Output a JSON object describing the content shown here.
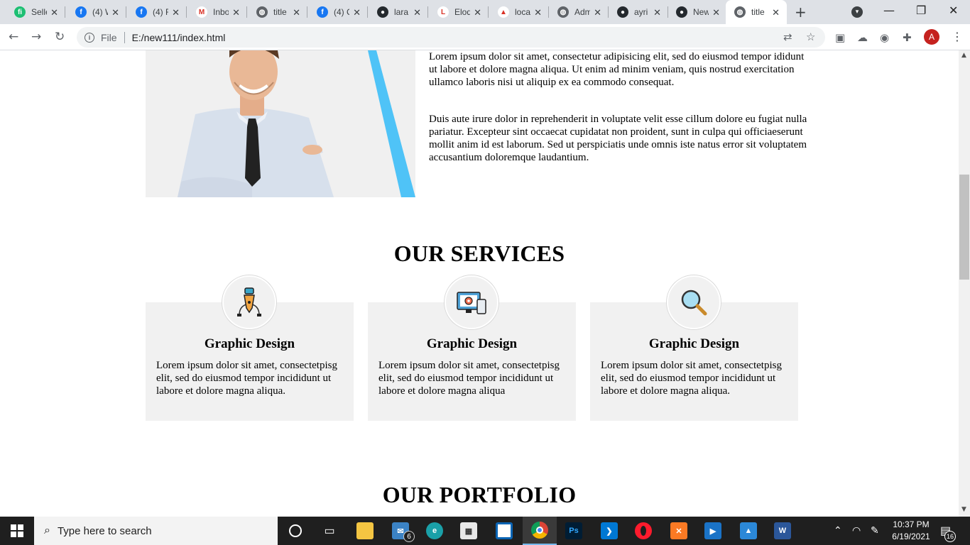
{
  "browser": {
    "tabs": [
      {
        "title": "Selle",
        "icon": "fiverr-icon",
        "color": "#1dbf73",
        "glyph": "fi"
      },
      {
        "title": "(4) W",
        "icon": "facebook-icon",
        "color": "#1877f2",
        "glyph": "f"
      },
      {
        "title": "(4) F",
        "icon": "facebook-icon",
        "color": "#1877f2",
        "glyph": "f"
      },
      {
        "title": "Inbo",
        "icon": "gmail-icon",
        "color": "#ffffff",
        "glyph": "M"
      },
      {
        "title": "title",
        "icon": "globe-icon",
        "color": "#5f6368",
        "glyph": "◍"
      },
      {
        "title": "(4) C",
        "icon": "facebook-icon",
        "color": "#1877f2",
        "glyph": "f"
      },
      {
        "title": "lara",
        "icon": "github-icon",
        "color": "#24292e",
        "glyph": "●"
      },
      {
        "title": "Eloq",
        "icon": "laravel-icon",
        "color": "#ffffff",
        "glyph": "L"
      },
      {
        "title": "loca",
        "icon": "phpmyadmin-icon",
        "color": "#ffffff",
        "glyph": "▲"
      },
      {
        "title": "Adm",
        "icon": "globe-icon",
        "color": "#5f6368",
        "glyph": "◍"
      },
      {
        "title": "ayri",
        "icon": "github-icon",
        "color": "#24292e",
        "glyph": "●"
      },
      {
        "title": "New",
        "icon": "github-icon",
        "color": "#24292e",
        "glyph": "●"
      },
      {
        "title": "title",
        "icon": "globe-icon",
        "color": "#5f6368",
        "glyph": "◍",
        "active": true
      }
    ],
    "close_glyph": "✕",
    "new_tab_glyph": "+",
    "address": {
      "scheme_chip": "File",
      "url": "E:/new111/index.html"
    },
    "profile_initial": "A"
  },
  "page": {
    "about": {
      "paragraphs": [
        "Lorem ipsum dolor sit amet, consectetur adipisicing elit, sed do eiusmod tempor ididunt ut labore et dolore magna aliqua. Ut enim ad minim veniam, quis nostrud exercitation ullamco laboris nisi ut aliquip ex ea commodo consequat.",
        "Duis aute irure dolor in reprehenderit in voluptate velit esse cillum dolore eu fugiat nulla pariatur. Excepteur sint occaecat cupidatat non proident, sunt in culpa qui officiaeserunt mollit anim id est laborum. Sed ut perspiciatis unde omnis iste natus error sit voluptatem accusantium doloremque laudantium."
      ]
    },
    "services": {
      "title": "OUR SERVICES",
      "cards": [
        {
          "icon": "pen-tool-icon",
          "title": "Graphic Design",
          "text": "Lorem ipsum dolor sit amet, consectetpisg elit, sed do eiusmod tempor incididunt ut labore et dolore magna aliqua."
        },
        {
          "icon": "monitor-gear-icon",
          "title": "Graphic Design",
          "text": "Lorem ipsum dolor sit amet, consectetpisg elit, sed do eiusmod tempor incididunt ut labore et dolore magna aliqua"
        },
        {
          "icon": "magnifier-icon",
          "title": "Graphic Design",
          "text": "Lorem ipsum dolor sit amet, consectetpisg elit, sed do eiusmod tempor incididunt ut labore et dolore magna aliqua."
        }
      ]
    },
    "portfolio": {
      "title": "OUR PORTFOLIO"
    }
  },
  "taskbar": {
    "search_placeholder": "Type here to search",
    "mail_badge": "6",
    "clock_time": "10:37 PM",
    "clock_date": "6/19/2021",
    "notification_count": "16"
  }
}
